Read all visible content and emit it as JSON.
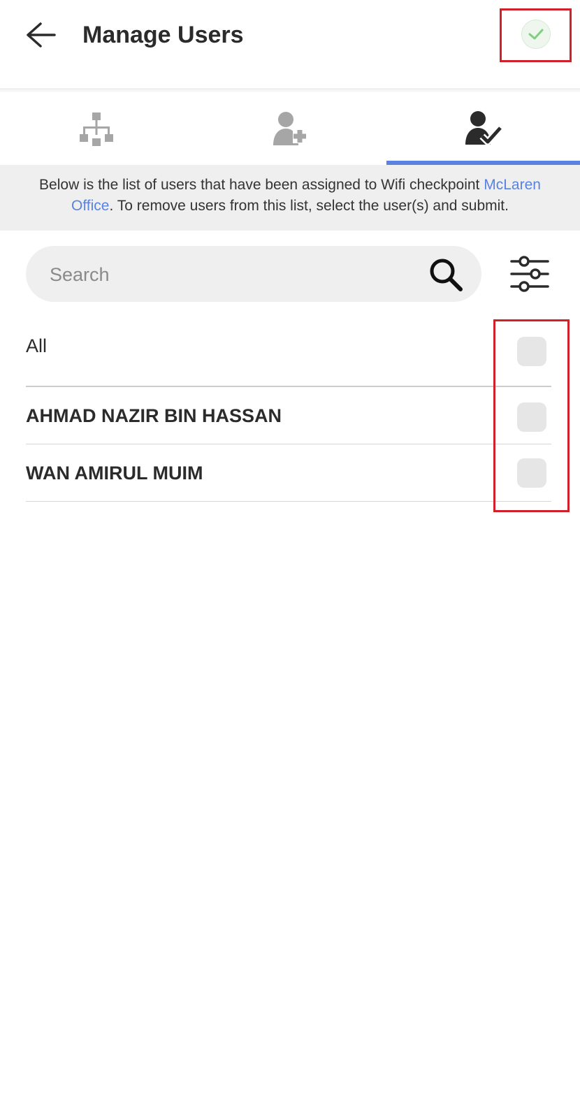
{
  "header": {
    "title": "Manage Users",
    "back_icon": "arrow-left-icon",
    "submit_icon": "check-circle-icon"
  },
  "tabs": [
    {
      "icon": "org-chart-icon",
      "active": false
    },
    {
      "icon": "user-add-icon",
      "active": false
    },
    {
      "icon": "user-check-icon",
      "active": true
    }
  ],
  "info": {
    "text_before": "Below is the list of users that have been assigned to Wifi checkpoint ",
    "link_text": "McLaren Office",
    "text_after": ". To remove users from this list, select the user(s) and submit."
  },
  "search": {
    "placeholder": "Search",
    "value": "",
    "icon": "search-icon",
    "filter_icon": "sliders-icon"
  },
  "select_all": {
    "label": "All",
    "checked": false
  },
  "users": [
    {
      "name": "AHMAD NAZIR BIN HASSAN",
      "checked": false
    },
    {
      "name": "WAN AMIRUL MUIM",
      "checked": false
    }
  ],
  "colors": {
    "accent": "#5a83df",
    "highlight": "#d0202a",
    "banner_bg": "#efefef",
    "checkbox_bg": "#e6e6e6",
    "submit_check": "#7ed07e"
  }
}
